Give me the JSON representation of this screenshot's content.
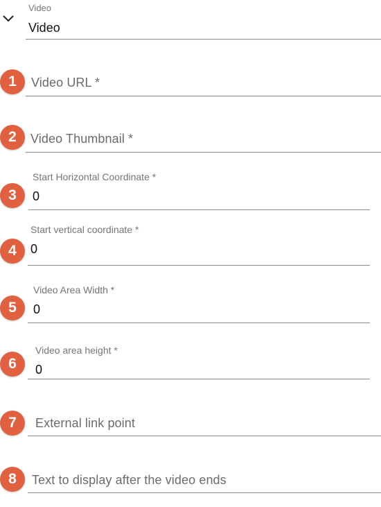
{
  "header": {
    "type_label": "Video",
    "type_value": "Video"
  },
  "fields": {
    "video_url": {
      "marker": "1",
      "placeholder": "Video URL *"
    },
    "video_thumbnail": {
      "marker": "2",
      "placeholder": "Video Thumbnail *"
    },
    "start_horizontal": {
      "marker": "3",
      "label": "Start Horizontal Coordinate *",
      "value": "0"
    },
    "start_vertical": {
      "marker": "4",
      "label": "Start vertical coordinate *",
      "value": "0"
    },
    "area_width": {
      "marker": "5",
      "label": "Video Area Width *",
      "value": "0"
    },
    "area_height": {
      "marker": "6",
      "label": "Video area height *",
      "value": "0"
    },
    "external_link": {
      "marker": "7",
      "placeholder": "External link point"
    },
    "end_text": {
      "marker": "8",
      "placeholder": "Text to display after the video ends"
    }
  },
  "colors": {
    "marker": "#e0603f",
    "underline": "#8a8a8a"
  },
  "icons": {
    "collapse": "chevron-down-icon"
  }
}
